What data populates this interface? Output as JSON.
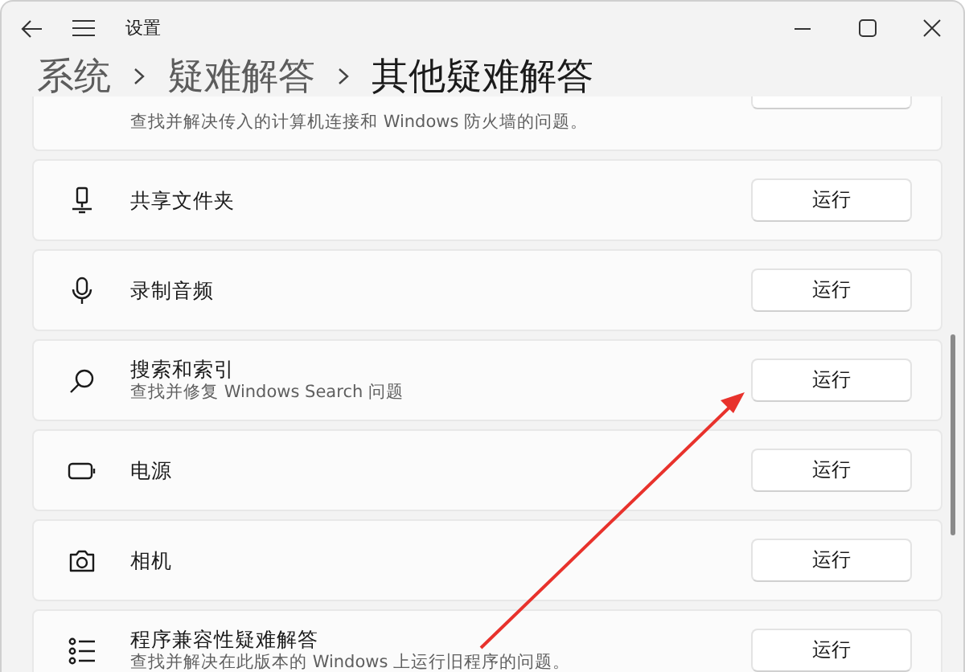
{
  "window": {
    "title": "设置"
  },
  "breadcrumb": [
    {
      "label": "系统",
      "current": false
    },
    {
      "label": "疑难解答",
      "current": false
    },
    {
      "label": "其他疑难解答",
      "current": true
    }
  ],
  "items": [
    {
      "kind": "partial",
      "description": "查找并解决传入的计算机连接和 Windows 防火墙的问题。"
    },
    {
      "kind": "row",
      "title": "共享文件夹",
      "button": "运行"
    },
    {
      "kind": "row",
      "title": "录制音频",
      "button": "运行"
    },
    {
      "kind": "row",
      "title": "搜索和索引",
      "description": "查找并修复 Windows Search 问题",
      "button": "运行"
    },
    {
      "kind": "row",
      "title": "电源",
      "button": "运行"
    },
    {
      "kind": "row",
      "title": "相机",
      "button": "运行"
    },
    {
      "kind": "row",
      "title": "程序兼容性疑难解答",
      "description": "查找并解决在此版本的 Windows 上运行旧程序的问题。",
      "button": "运行"
    }
  ]
}
